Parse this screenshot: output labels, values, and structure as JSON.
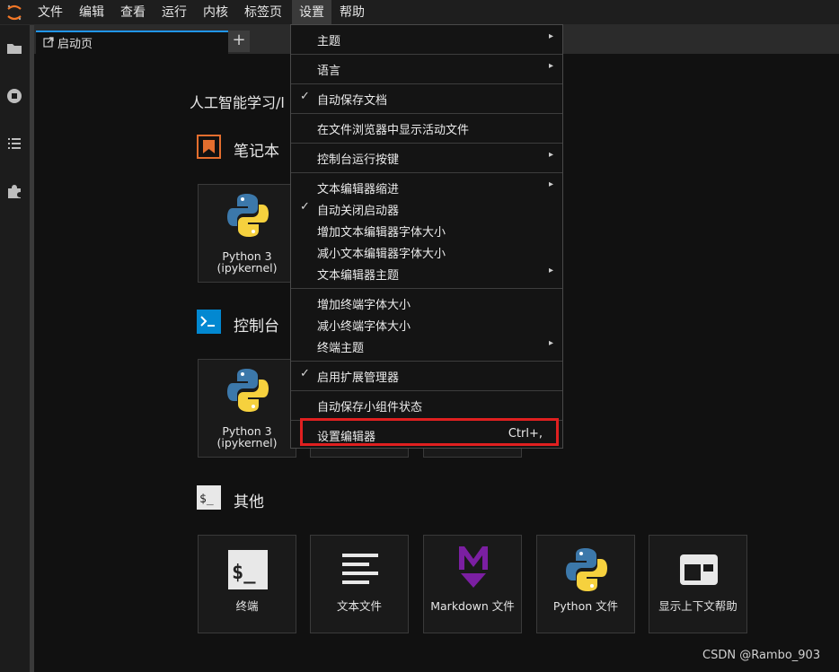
{
  "menubar": {
    "items": [
      "文件",
      "编辑",
      "查看",
      "运行",
      "内核",
      "标签页",
      "设置",
      "帮助"
    ],
    "active": "设置"
  },
  "sidebar": {
    "icons": [
      "folder-icon",
      "running-icon",
      "table-of-contents-icon",
      "extension-icon"
    ]
  },
  "tabs": {
    "launcher_label": "启动页",
    "add_label": "+"
  },
  "launcher": {
    "title": "人工智能学习/l",
    "sections": {
      "notebook": {
        "title": "笔记本",
        "cards": [
          {
            "label_line1": "Python 3",
            "label_line2": "(ipykernel)"
          }
        ]
      },
      "console": {
        "title": "控制台",
        "cards": [
          {
            "label_line1": "Python 3",
            "label_line2": "(ipykernel)"
          }
        ]
      },
      "other": {
        "title": "其他",
        "cards": [
          {
            "label": "终端",
            "icon": "terminal-icon"
          },
          {
            "label": "文本文件",
            "icon": "text-file-icon"
          },
          {
            "label": "Markdown 文件",
            "icon": "markdown-icon"
          },
          {
            "label": "Python 文件",
            "icon": "python-icon"
          },
          {
            "label": "显示上下文帮助",
            "icon": "context-help-icon"
          }
        ]
      }
    }
  },
  "settings_menu": {
    "items": [
      {
        "label": "主题",
        "submenu": true,
        "checked": false
      },
      {
        "label": "语言",
        "submenu": true,
        "checked": false
      },
      {
        "label": "自动保存文档",
        "submenu": false,
        "checked": true
      },
      {
        "label": "在文件浏览器中显示活动文件",
        "submenu": false,
        "checked": false
      },
      {
        "label": "控制台运行按键",
        "submenu": true,
        "checked": false
      },
      {
        "label": "文本编辑器缩进",
        "submenu": true,
        "checked": false
      },
      {
        "label": "自动关闭启动器",
        "submenu": false,
        "checked": true
      },
      {
        "label": "增加文本编辑器字体大小",
        "submenu": false,
        "checked": false
      },
      {
        "label": "减小文本编辑器字体大小",
        "submenu": false,
        "checked": false
      },
      {
        "label": "文本编辑器主题",
        "submenu": true,
        "checked": false
      },
      {
        "label": "增加终端字体大小",
        "submenu": false,
        "checked": false
      },
      {
        "label": "减小终端字体大小",
        "submenu": false,
        "checked": false
      },
      {
        "label": "终端主题",
        "submenu": true,
        "checked": false
      },
      {
        "label": "启用扩展管理器",
        "submenu": false,
        "checked": true
      },
      {
        "label": "自动保存小组件状态",
        "submenu": false,
        "checked": false
      },
      {
        "label": "设置编辑器",
        "submenu": false,
        "checked": false,
        "shortcut": "Ctrl+,"
      }
    ],
    "check_glyph": "✓",
    "arrow_glyph": "▸"
  },
  "colors": {
    "accent_blue": "#2196f3",
    "highlight_red": "#e02020",
    "jupyter_orange": "#f37726",
    "notebook_orange": "#e46e2e",
    "console_blue": "#0288d1",
    "markdown_purple": "#7b1fa2"
  },
  "watermark": "CSDN @Rambo_903"
}
